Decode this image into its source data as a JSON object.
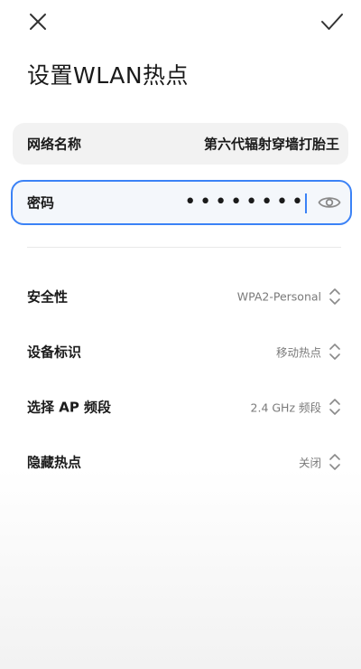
{
  "header": {
    "close_icon": "close-icon",
    "confirm_icon": "check-icon",
    "title": "设置WLAN热点"
  },
  "fields": {
    "network_name_label": "网络名称",
    "network_name_value": "第六代辐射穿墙打胎王",
    "password_label": "密码",
    "password_masked": "••••••••",
    "password_visibility_icon": "eye-icon"
  },
  "settings": {
    "security_label": "安全性",
    "security_value": "WPA2-Personal",
    "device_id_label": "设备标识",
    "device_id_value": "移动热点",
    "band_label": "选择 AP 频段",
    "band_value": "2.4 GHz 频段",
    "hidden_label": "隐藏热点",
    "hidden_value": "关闭",
    "selector_icon": "chevron-up-down-icon"
  },
  "colors": {
    "accent": "#3b82f6",
    "field_bg": "#f2f2f2",
    "secondary_text": "#7a7a7a"
  }
}
